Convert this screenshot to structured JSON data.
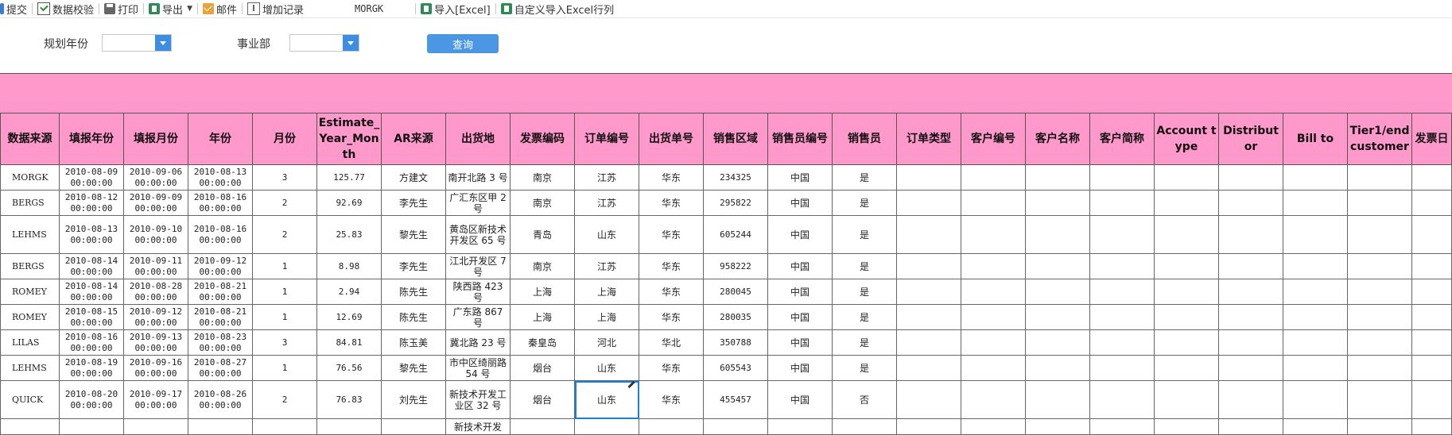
{
  "toolbar": {
    "items": [
      {
        "label": "提交",
        "icon": "submit-icon"
      },
      {
        "label": "数据校验",
        "icon": "check-icon"
      },
      {
        "label": "打印",
        "icon": "print-icon"
      },
      {
        "label": "导出",
        "icon": "export-icon"
      },
      {
        "label": "邮件",
        "icon": "mail-icon"
      },
      {
        "label": "增加记录",
        "icon": "add-record-icon"
      }
    ],
    "current_value": "MORGK",
    "import_excel": "导入[Excel]",
    "custom_import": "自定义导入Excel行列"
  },
  "filters": {
    "year_label": "规划年份",
    "division_label": "事业部",
    "year_value": "",
    "division_value": "",
    "query_button": "查询"
  },
  "table": {
    "columns": [
      "数据来源",
      "填报年份",
      "填报月份",
      "年份",
      "月份",
      "Estimate_Year_Month",
      "AR来源",
      "出货地",
      "发票编码",
      "订单编号",
      "出货单号",
      "销售区域",
      "销售员编号",
      "销售员",
      "订单类型",
      "客户编号",
      "客户名称",
      "客户简称",
      "Account type",
      "Distributor",
      "Bill to",
      "Tier1/end customer",
      "发票日"
    ],
    "rows": [
      {
        "src": "MORGK",
        "fill_year": "2010-08-09 00:00:00",
        "fill_month": "2010-09-06 00:00:00",
        "year": "2010-08-13 00:00:00",
        "month": "3",
        "estimate": "125.77",
        "ar": "方建文",
        "ship": "南开北路 3 号",
        "invoice": "南京",
        "order": "江苏",
        "shipno": "华东",
        "region": "234325",
        "salesno": "中国",
        "sales": "是"
      },
      {
        "src": "BERGS",
        "fill_year": "2010-08-12 00:00:00",
        "fill_month": "2010-09-09 00:00:00",
        "year": "2010-08-16 00:00:00",
        "month": "2",
        "estimate": "92.69",
        "ar": "李先生",
        "ship": "广汇东区甲 2 号",
        "invoice": "南京",
        "order": "江苏",
        "shipno": "华东",
        "region": "295822",
        "salesno": "中国",
        "sales": "是"
      },
      {
        "src": "LEHMS",
        "fill_year": "2010-08-13 00:00:00",
        "fill_month": "2010-09-10 00:00:00",
        "year": "2010-08-16 00:00:00",
        "month": "2",
        "estimate": "25.83",
        "ar": "黎先生",
        "ship": "黄岛区新技术开发区 65 号",
        "invoice": "青岛",
        "order": "山东",
        "shipno": "华东",
        "region": "605244",
        "salesno": "中国",
        "sales": "是"
      },
      {
        "src": "BERGS",
        "fill_year": "2010-08-14 00:00:00",
        "fill_month": "2010-09-11 00:00:00",
        "year": "2010-09-12 00:00:00",
        "month": "1",
        "estimate": "8.98",
        "ar": "李先生",
        "ship": "江北开发区 7 号",
        "invoice": "南京",
        "order": "江苏",
        "shipno": "华东",
        "region": "958222",
        "salesno": "中国",
        "sales": "是"
      },
      {
        "src": "ROMEY",
        "fill_year": "2010-08-14 00:00:00",
        "fill_month": "2010-08-28 00:00:00",
        "year": "2010-08-21 00:00:00",
        "month": "1",
        "estimate": "2.94",
        "ar": "陈先生",
        "ship": "陕西路 423 号",
        "invoice": "上海",
        "order": "上海",
        "shipno": "华东",
        "region": "280045",
        "salesno": "中国",
        "sales": "是"
      },
      {
        "src": "ROMEY",
        "fill_year": "2010-08-15 00:00:00",
        "fill_month": "2010-09-12 00:00:00",
        "year": "2010-08-21 00:00:00",
        "month": "1",
        "estimate": "12.69",
        "ar": "陈先生",
        "ship": "广东路 867 号",
        "invoice": "上海",
        "order": "上海",
        "shipno": "华东",
        "region": "280035",
        "salesno": "中国",
        "sales": "是"
      },
      {
        "src": "LILAS",
        "fill_year": "2010-08-16 00:00:00",
        "fill_month": "2010-09-13 00:00:00",
        "year": "2010-08-23 00:00:00",
        "month": "3",
        "estimate": "84.81",
        "ar": "陈玉美",
        "ship": "冀北路 23 号",
        "invoice": "秦皇岛",
        "order": "河北",
        "shipno": "华北",
        "region": "350788",
        "salesno": "中国",
        "sales": "是"
      },
      {
        "src": "LEHMS",
        "fill_year": "2010-08-19 00:00:00",
        "fill_month": "2010-09-16 00:00:00",
        "year": "2010-08-27 00:00:00",
        "month": "1",
        "estimate": "76.56",
        "ar": "黎先生",
        "ship": "市中区绮丽路 54 号",
        "invoice": "烟台",
        "order": "山东",
        "shipno": "华东",
        "region": "605543",
        "salesno": "中国",
        "sales": "是"
      },
      {
        "src": "QUICK",
        "fill_year": "2010-08-20 00:00:00",
        "fill_month": "2010-09-17 00:00:00",
        "year": "2010-08-26 00:00:00",
        "month": "2",
        "estimate": "76.83",
        "ar": "刘先生",
        "ship": "新技术开发工业区 32 号",
        "invoice": "烟台",
        "order": "山东",
        "shipno": "华东",
        "region": "455457",
        "salesno": "中国",
        "sales": "否"
      },
      {
        "src": "",
        "fill_year": "",
        "fill_month": "",
        "year": "",
        "month": "",
        "estimate": "",
        "ar": "",
        "ship": "新技术开发",
        "invoice": "",
        "order": "",
        "shipno": "",
        "region": "",
        "salesno": "",
        "sales": ""
      }
    ]
  }
}
